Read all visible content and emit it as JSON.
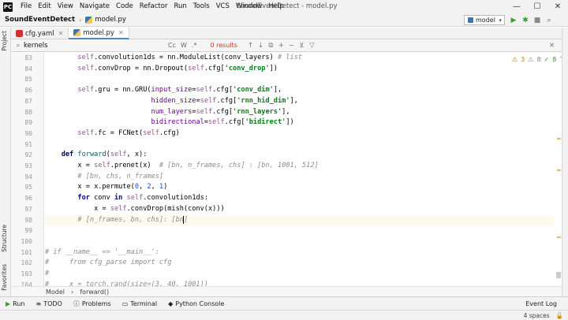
{
  "menu": {
    "items": [
      "File",
      "Edit",
      "View",
      "Navigate",
      "Code",
      "Refactor",
      "Run",
      "Tools",
      "VCS",
      "Window",
      "Help"
    ],
    "window_title": "SoundEventDetect - model.py"
  },
  "navbar": {
    "project": "SoundEventDetect",
    "file": "model.py",
    "run_config": "model"
  },
  "side_tabs": {
    "project": "Project",
    "structure": "Structure",
    "favorites": "Favorites"
  },
  "tabs": [
    {
      "label": "cfg.yaml"
    },
    {
      "label": "model.py"
    }
  ],
  "find": {
    "query": "kernels",
    "match_case": "Cc",
    "words": "W",
    "regex": ".*",
    "results": "0 results"
  },
  "inspections": {
    "warnings": "3",
    "weak_warnings": "8",
    "typos": "8"
  },
  "code": {
    "line_numbers": [
      "83",
      "84",
      "85",
      "86",
      "87",
      "88",
      "89",
      "90",
      "91",
      "92",
      "93",
      "94",
      "95",
      "96",
      "97",
      "98",
      "99",
      "100",
      "101",
      "102",
      "103",
      "104"
    ]
  },
  "breadcrumbs": {
    "class": "Model",
    "method": "forward()"
  },
  "tool_windows": {
    "run": "Run",
    "todo": "TODO",
    "problems": "Problems",
    "terminal": "Terminal",
    "python_console": "Python Console",
    "event_log": "Event Log"
  },
  "status": {
    "spaces": "4 spaces"
  }
}
